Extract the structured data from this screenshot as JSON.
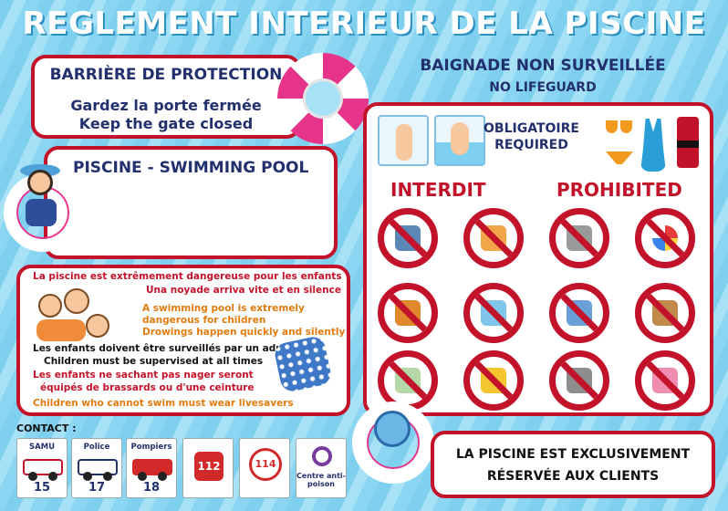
{
  "title": "REGLEMENT INTERIEUR DE LA PISCINE",
  "barrier": {
    "heading": "BARRIÈRE DE PROTECTION",
    "line1": "Gardez la porte fermée",
    "line2": "Keep the gate closed"
  },
  "pool": {
    "heading": "PISCINE - SWIMMING POOL"
  },
  "danger": {
    "l1": "La piscine est extrêmement dangereuse pour les enfants",
    "l2": "Una noyade arriva vite et en silence",
    "l3": "A swimming pool is extremely",
    "l4": "dangerous for children",
    "l5": "Drowings happen quickly and silently",
    "l6": "Les enfants doivent être surveillés par un adulte",
    "l7": "Children must be supervised at all times",
    "l8": "Les enfants ne sachant pas nager seront",
    "l9": "équipés de brassards ou d'une ceinture",
    "l10": "Children who cannot swim must wear livesavers"
  },
  "contact": {
    "label": "CONTACT :",
    "items": [
      {
        "label": "SAMU",
        "number": "15"
      },
      {
        "label": "Police",
        "number": "17"
      },
      {
        "label": "Pompiers",
        "number": "18"
      },
      {
        "label": "",
        "number": "112"
      },
      {
        "label": "",
        "number": "114"
      },
      {
        "label": "Centre anti-poison",
        "number": ""
      }
    ]
  },
  "right": {
    "baignade": "BAIGNADE NON SURVEILLÉE",
    "no_lifeguard": "NO LIFEGUARD",
    "required_fr": "OBLIGATOIRE",
    "required_en": "REQUIRED",
    "interdit": "INTERDIT",
    "prohibited": "PROHIBITED"
  },
  "prohibited_icons": [
    "no-diving-icon",
    "no-running-icon",
    "no-smoking-icon",
    "no-ball-icon",
    "no-food-icon",
    "no-jumping-icon",
    "no-shoes-icon",
    "no-pets-icon",
    "no-glass-icon",
    "no-inflatables-icon",
    "no-sharp-objects-icon",
    "no-music-icon"
  ],
  "exclusive": {
    "line1": "LA PISCINE EST EXCLUSIVEMENT",
    "line2": "RÉSERVÉE AUX CLIENTS"
  },
  "colors": {
    "accent_red": "#c3132a",
    "navy": "#23306e",
    "orange": "#e27b0d",
    "water": "#8ad6f2"
  }
}
